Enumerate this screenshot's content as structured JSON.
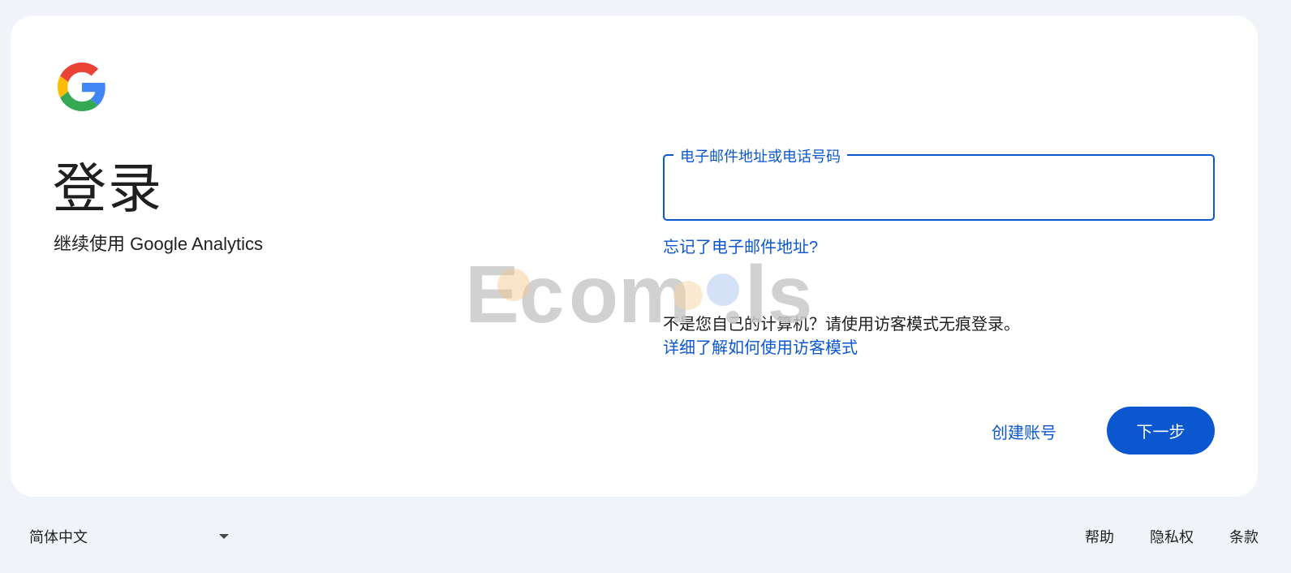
{
  "card": {
    "title": "登录",
    "subtitle": "继续使用 Google Analytics"
  },
  "logo": {
    "icon": "google-g-icon",
    "colors": [
      "#ea4335",
      "#fbbc05",
      "#34a853",
      "#4285f4"
    ]
  },
  "email_field": {
    "label": "电子邮件地址或电话号码",
    "value": ""
  },
  "links": {
    "forgot_email": "忘记了电子邮件地址?",
    "guest_notice": "不是您自己的计算机？请使用访客模式无痕登录。",
    "learn_more": "详细了解如何使用访客模式"
  },
  "actions": {
    "create_account": "创建账号",
    "next": "下一步"
  },
  "watermark": {
    "text_left": "Ec",
    "text_mid": "om",
    "text_right": "ls"
  },
  "footer": {
    "language": "简体中文",
    "links": [
      "帮助",
      "隐私权",
      "条款"
    ]
  },
  "colors": {
    "accent": "#0b57d0",
    "background": "#f0f4f9",
    "card": "#ffffff"
  }
}
